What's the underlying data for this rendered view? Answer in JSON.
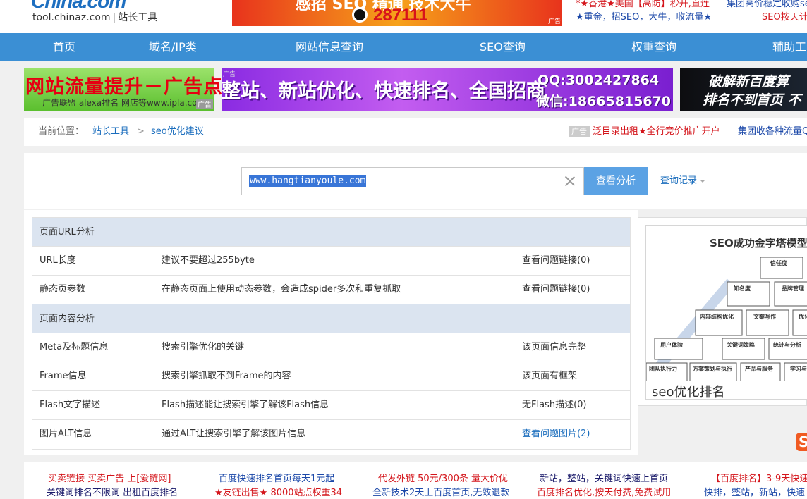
{
  "header": {
    "logo_word": "China",
    "logo_com": ".com",
    "logo_domain": "tool.chinaz.com",
    "logo_sep": "|",
    "logo_tool": "站长工具",
    "banner": {
      "headline": "感招 SEO 精通 技术大牛",
      "qq_number": "287111",
      "tag": "广告"
    },
    "top_links": {
      "l1": "*★香港★美国【高防】秒开,直连",
      "l2": "★重金，招SEO，大牛，收流量★",
      "r1": "集团高价稳定收购se",
      "r2": "SEO按天计"
    }
  },
  "nav": {
    "items": [
      "首页",
      "域名/IP类",
      "网站信息查询",
      "SEO查询",
      "权重查询",
      "辅助工"
    ]
  },
  "ads": {
    "ad1": {
      "headline": "网站流量提升－广告点击",
      "sub": "广告联盟 alexa排名 网店等www.ipla.com",
      "tag": "广告"
    },
    "ad2": {
      "headline": "整站、新站优化、快速排名、全国招商",
      "qq": "QQ:3002427864",
      "wechat": "微信:18665815670",
      "tag": "广告"
    },
    "ad3": {
      "line1": "破解新百度算",
      "line2": "排名不到首页 不"
    }
  },
  "breadcrumb": {
    "label": "当前位置：",
    "home": "站长工具",
    "arrow": ">",
    "current": "seo优化建议",
    "ad_tag": "广告",
    "ad_a": "泛目录出租★全行竞价推广开户",
    "ad_b": "集团收各种流量Q"
  },
  "search": {
    "value": "www.hangtianyoule.com",
    "button": "查看分析",
    "history": "查询记录"
  },
  "analysis": {
    "url_section": "页面URL分析",
    "url_rows": [
      {
        "name": "URL长度",
        "desc": "建议不要超过255byte",
        "result": "查看问题链接(0)"
      },
      {
        "name": "静态页参数",
        "desc": "在静态页面上使用动态参数，会造成spider多次和重复抓取",
        "result": "查看问题链接(0)"
      }
    ],
    "content_section": "页面内容分析",
    "content_rows": [
      {
        "name": "Meta及标题信息",
        "desc": "搜索引擎优化的关键",
        "result": "该页面信息完整"
      },
      {
        "name": "Frame信息",
        "desc": "搜索引擎抓取不到Frame的内容",
        "result": "该页面有框架"
      },
      {
        "name": "Flash文字描述",
        "desc": "Flash描述能让搜索引擎了解该Flash信息",
        "result": "无Flash描述(0)"
      },
      {
        "name": "图片ALT信息",
        "desc": "通过ALT让搜索引擎了解该图片信息",
        "result": "查看问题图片(2)"
      }
    ]
  },
  "side": {
    "title": "SEO成功金字塔模型",
    "caption": "seo优化排名",
    "blocks": [
      "信任度",
      "知名度",
      "品牌管理",
      "内部结构优化",
      "文案写作",
      "优化",
      "用户体验",
      "关键词策略",
      "统计与分析",
      "团队执行力",
      "方案策划与执行",
      "产品与服务",
      "学习与"
    ]
  },
  "bottom": {
    "col1": [
      "买卖链接 买卖广告 上[爱链网]",
      "关键词排名不限词 出租百度排名"
    ],
    "col2": [
      "百度快速排名首页每天1元起",
      "★友链出售★ 8000站点权重34"
    ],
    "col3": [
      "代发外链 50元/300条 量大价优",
      "全新技术2天上百度首页,无效退款"
    ],
    "col4": [
      "新站，整站，关键词快速上首页",
      "百度排名优化,按天付费,免费试用"
    ],
    "col5": [
      "【百度排名】3-9天快速",
      "快排，整站，新站，快速"
    ]
  }
}
